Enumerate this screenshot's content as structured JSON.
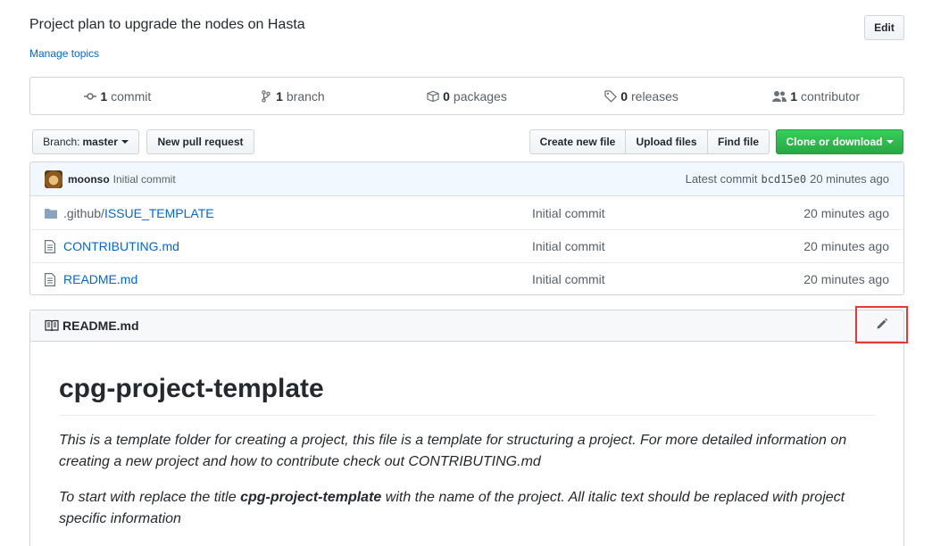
{
  "repo": {
    "description": "Project plan to upgrade the nodes on Hasta",
    "manage_topics": "Manage topics",
    "edit_label": "Edit"
  },
  "summary": {
    "commits": {
      "count": "1",
      "label": "commit",
      "icon": "commit-icon"
    },
    "branches": {
      "count": "1",
      "label": "branch",
      "icon": "branch-icon"
    },
    "packages": {
      "count": "0",
      "label": "packages",
      "icon": "package-icon"
    },
    "releases": {
      "count": "0",
      "label": "releases",
      "icon": "tag-icon"
    },
    "contributors": {
      "count": "1",
      "label": "contributor",
      "icon": "people-icon"
    }
  },
  "toolbar": {
    "branch_prefix": "Branch:",
    "branch_name": "master",
    "new_pr": "New pull request",
    "create_file": "Create new file",
    "upload_files": "Upload files",
    "find_file": "Find file",
    "clone": "Clone or download"
  },
  "latest_commit": {
    "author": "moonso",
    "message": "Initial commit",
    "latest_label": "Latest commit",
    "sha": "bcd15e0",
    "age": "20 minutes ago"
  },
  "files": [
    {
      "prefix": ".github/",
      "name": "ISSUE_TEMPLATE",
      "type": "folder",
      "message": "Initial commit",
      "age": "20 minutes ago"
    },
    {
      "prefix": "",
      "name": "CONTRIBUTING.md",
      "type": "file",
      "message": "Initial commit",
      "age": "20 minutes ago"
    },
    {
      "prefix": "",
      "name": "README.md",
      "type": "file",
      "message": "Initial commit",
      "age": "20 minutes ago"
    }
  ],
  "readme": {
    "filename": "README.md",
    "heading": "cpg-project-template",
    "para1": "This is a template folder for creating a project, this file is a template for structuring a project. For more detailed information on creating a new project and how to contribute check out CONTRIBUTING.md",
    "para2_start": "To start with replace the title ",
    "para2_bold": "cpg-project-template",
    "para2_end": " with the name of the project. All italic text should be replaced with project specific information"
  },
  "colors": {
    "accent": "#0366d6",
    "clone_green": "#28a745",
    "highlight_red": "#e53935"
  }
}
